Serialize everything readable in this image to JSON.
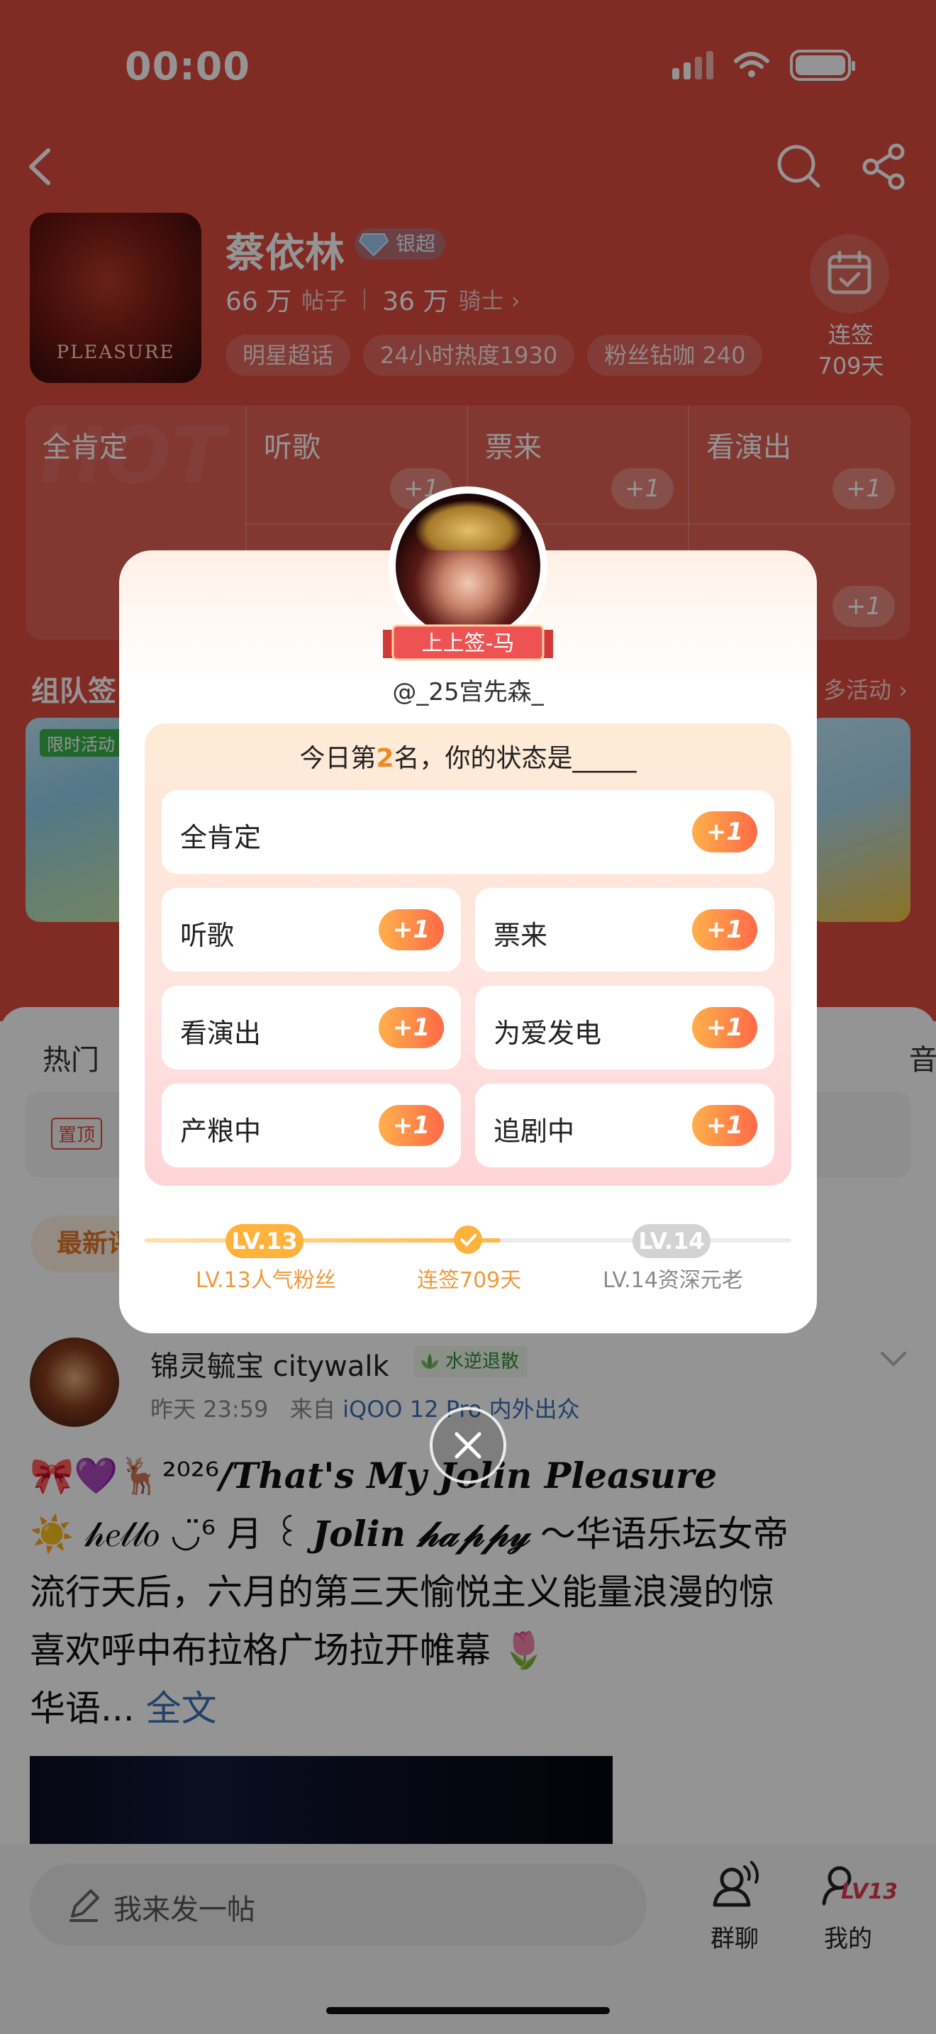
{
  "status_bar": {
    "time": "00:00"
  },
  "forum": {
    "name": "蔡依林",
    "badge": "银超",
    "avatar_caption": "PLEASURE",
    "posts_count": "66 万",
    "posts_label": "帖子",
    "knights_count": "36 万",
    "knights_label": "骑士 ›",
    "chips": [
      "明星超话",
      "24小时热度1930",
      "粉丝钻咖 240"
    ],
    "checkin_label": "连签",
    "checkin_days": "709天"
  },
  "hot_grid": {
    "watermark": "HOT",
    "cells": [
      "全肯定",
      "听歌",
      "票来",
      "看演出"
    ],
    "plus": "+1"
  },
  "team_section": {
    "title": "组队签",
    "more": "多活动 ›",
    "tag": "限时活动"
  },
  "tabs": [
    "热门",
    "音"
  ],
  "pinned": {
    "tag": "置顶"
  },
  "latest_chip": "最新评",
  "post": {
    "author": "锦灵毓宝 citywalk",
    "badge": "水逆退散",
    "time": "昨天 23:59",
    "from": "来自",
    "device": "iQOO 12 Pro 内外出众",
    "line1_emoji": "🎀💜🦌²⁰²⁶",
    "line1_text": "/That's My Jolin Pleasure",
    "line2_a": "☀️ 𝒽𝑒𝓁𝓁𝑜 ◡̈⁶ 月 ꒰ ",
    "line2_b": "Jolin 𝒽𝒶𝓅𝓅𝓎",
    "line2_c": " ～华语乐坛女帝",
    "line3": "流行天后，六月的第三天愉悦主义能量浪漫的惊",
    "line4": "喜欢呼中布拉格广场拉开帷幕 🌷",
    "line5": "华语... ",
    "more": "全文"
  },
  "bottom_bar": {
    "compose_placeholder": "我来发一帖",
    "group_chat": "群聊",
    "mine": "我的",
    "level_tag": "LV13"
  },
  "modal": {
    "rank_ribbon": "上上签-马",
    "username": "@_25宫先森_",
    "question_prefix": "今日第",
    "rank": "2",
    "question_suffix": "名，你的状态是_____",
    "options": [
      {
        "label": "全肯定",
        "plus": "+1"
      },
      {
        "label": "听歌",
        "plus": "+1"
      },
      {
        "label": "票来",
        "plus": "+1"
      },
      {
        "label": "看演出",
        "plus": "+1"
      },
      {
        "label": "为爱发电",
        "plus": "+1"
      },
      {
        "label": "产粮中",
        "plus": "+1"
      },
      {
        "label": "追剧中",
        "plus": "+1"
      }
    ],
    "level_current": "LV.13",
    "level_next": "LV.14",
    "level_current_caption": "LV.13人气粉丝",
    "streak_caption": "连签709天",
    "level_next_caption": "LV.14资深元老",
    "progress_fraction": 0.55,
    "colors": {
      "accent_orange": "#ffb23c",
      "plus_gradient_start": "#ffb04a",
      "plus_gradient_end": "#ff6a48"
    }
  }
}
